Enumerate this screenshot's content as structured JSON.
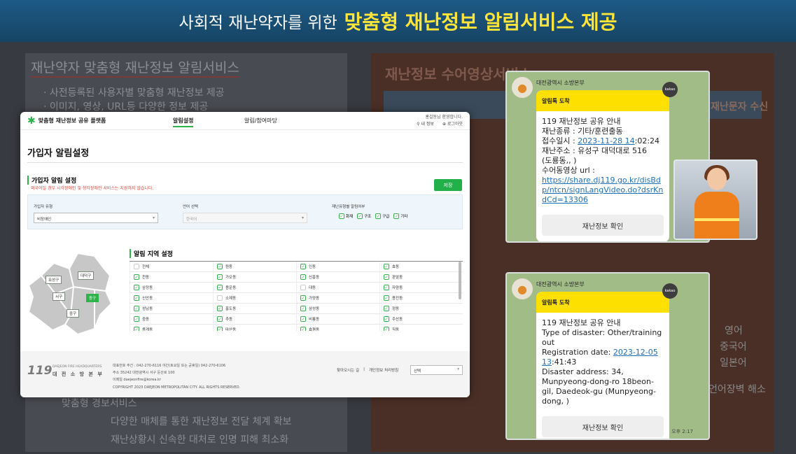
{
  "banner": {
    "pre": "사회적 재난약자를 위한",
    "highlight": "맞춤형 재난정보 알림서비스 제공"
  },
  "background": {
    "left_title": "재난약자 맞춤형 재난정보 알림서비스",
    "left_bullets": [
      "· 사전등록된 사용자별 맞춤형 재난정보 제공",
      "· 이미지, 영상, URL등 다양한 정보 제공"
    ],
    "left_bottom": [
      "맞춤형 경보서비스",
      "다양한 매체를 통한 재난정보 전달 체계 확보",
      "재난상황시 신속한 대처로 인명 피해 최소화"
    ],
    "right_title": "재난정보 수어영상서비스",
    "right_items": [
      "재난문자 수신",
      "영어",
      "중국어",
      "일본어",
      "언어장벽 해소"
    ]
  },
  "window": {
    "logo": "맞춤형 재난정보 공유 플랫폼",
    "nav": [
      "알림설정",
      "알림/참여마당"
    ],
    "greeting": "홍길동님 환영합니다.",
    "user_menu": [
      "내 정보",
      "로그아웃"
    ],
    "page_title": "가입자 알림설정",
    "section_title": "가입자 알림 설정",
    "section_note": "외국어일 경우 시각장애인 및 청각장애인 서비스는 지원하지 않습니다.",
    "save_label": "저장",
    "form": {
      "type_label": "가입자 유형",
      "type_value": "비장애인",
      "lang_label": "언어 선택",
      "lang_value": "한국어",
      "disaster_label": "재난유형별 알림여부",
      "disaster_opts": [
        "화재",
        "구조",
        "구급",
        "기타"
      ]
    },
    "map_labels": [
      "유성구",
      "대덕구",
      "서구",
      "동구",
      "중구"
    ],
    "region_title": "알림 지역 설정",
    "regions": [
      [
        {
          "n": "전체",
          "c": false
        },
        {
          "n": "원동",
          "c": true
        },
        {
          "n": "인동",
          "c": true
        },
        {
          "n": "효동",
          "c": true
        }
      ],
      [
        {
          "n": "천동",
          "c": true
        },
        {
          "n": "가오동",
          "c": true
        },
        {
          "n": "신흥동",
          "c": true
        },
        {
          "n": "판암동",
          "c": true
        }
      ],
      [
        {
          "n": "삼정동",
          "c": true
        },
        {
          "n": "용운동",
          "c": true
        },
        {
          "n": "대동",
          "c": false
        },
        {
          "n": "자양동",
          "c": true
        }
      ],
      [
        {
          "n": "신안동",
          "c": true
        },
        {
          "n": "소제동",
          "c": false
        },
        {
          "n": "가양동",
          "c": true
        },
        {
          "n": "용전동",
          "c": true
        }
      ],
      [
        {
          "n": "성남동",
          "c": true
        },
        {
          "n": "홍도동",
          "c": true
        },
        {
          "n": "삼성동",
          "c": true
        },
        {
          "n": "정동",
          "c": true
        }
      ],
      [
        {
          "n": "중동",
          "c": true
        },
        {
          "n": "추동",
          "c": true
        },
        {
          "n": "비룡동",
          "c": true
        },
        {
          "n": "주산동",
          "c": true
        }
      ],
      [
        {
          "n": "용계동",
          "c": true
        },
        {
          "n": "마산동",
          "c": true
        },
        {
          "n": "효평동",
          "c": true
        },
        {
          "n": "직동",
          "c": true
        }
      ]
    ],
    "footer": {
      "logo_mark": "119",
      "logo_en": "DAEJEON FIRE HEADQUARTERS",
      "logo_kr": "대 전 소 방 본 부",
      "info1": "대표번호 주간 : 042-270-6116 야간(토요일 또는 공휴일) 042-270-6106",
      "info2": "주소 35242 대전광역시 서구 둔산로 100",
      "info3": "이메일 daejeonfire@korea.kr",
      "copyright": "COPYRIGHT 2023 DAEJEON METROPOLITAN CITY. ALL RIGHTS RESERVED.",
      "links": [
        "찾아오시는 길",
        "개인정보 처리방침"
      ],
      "select": "선택"
    }
  },
  "chat1": {
    "sender": "대전광역시 소방본부",
    "header": "알림톡 도착",
    "badge": "kakao",
    "l1": "119 재난정보 공유 안내",
    "l2": "재난종류 : 기타/훈련출동",
    "l3a": "접수일시 : ",
    "l3b": "2023-11-28 14",
    "l3c": ":02:24",
    "l4": "재난주소 : 유성구 대덕대로 516",
    "l5": "(도룡동,, )",
    "l6": "수어동영상 url :",
    "url": "https://share.dj119.go.kr/disBdp/ntcn/signLangVideo.do?dsrKndCd=13306",
    "button": "재난정보 확인"
  },
  "chat2": {
    "sender": "대전광역시 소방본부",
    "header": "알림톡 도착",
    "badge": "kakao",
    "l1": "119 재난정보 공유 안내",
    "l2": "Type of disaster: Other/training out",
    "l3a": "Registration date: ",
    "l3b": "2023-12-05 13",
    "l3c": ":41:43",
    "l4": "Disaster address: 34, Munpyeong-dong-ro 18beon-gil, Daedeok-gu (Munpyeong-dong, )",
    "button": "재난정보 확인",
    "time": "오후 2:17"
  }
}
